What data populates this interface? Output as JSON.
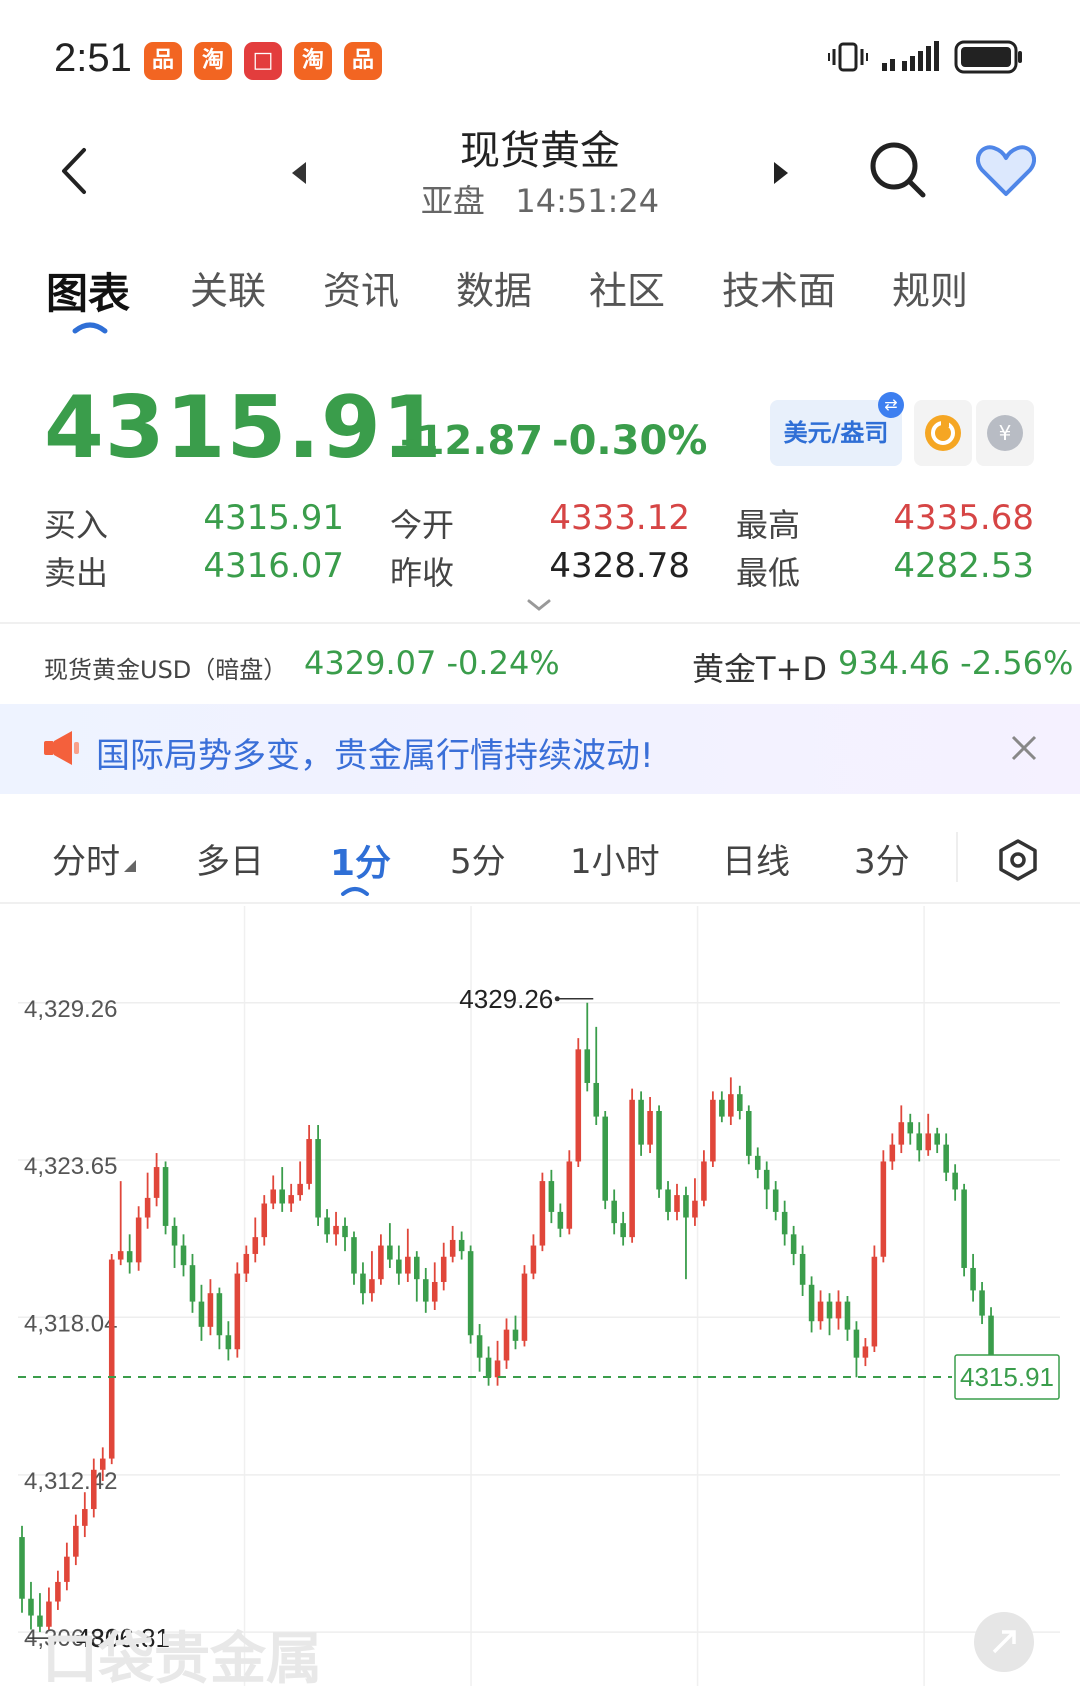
{
  "status_bar": {
    "time": "2:51",
    "apps": [
      {
        "glyph": "品",
        "color": "#f26522"
      },
      {
        "glyph": "淘",
        "color": "#f26522"
      },
      {
        "glyph": "□",
        "color": "#e33d3d"
      },
      {
        "glyph": "淘",
        "color": "#f26522"
      },
      {
        "glyph": "品",
        "color": "#f26522"
      }
    ]
  },
  "header": {
    "title": "现货黄金",
    "session": "亚盘",
    "time": "14:51:24"
  },
  "tabs": [
    "图表",
    "关联",
    "资讯",
    "数据",
    "社区",
    "技术面",
    "规则"
  ],
  "quote": {
    "price": "4315.91",
    "change": "-12.87",
    "change_pct": "-0.30%",
    "currency_toggle": "美元/盎司",
    "buy_label": "买入",
    "buy": "4315.91",
    "sell_label": "卖出",
    "sell": "4316.07",
    "open_label": "今开",
    "open": "4333.12",
    "prev_close_label": "昨收",
    "prev_close": "4328.78",
    "high_label": "最高",
    "high": "4335.68",
    "low_label": "最低",
    "low": "4282.53"
  },
  "related": {
    "left_name": "现货黄金USD（暗盘）",
    "left_value": "4329.07 -0.24%",
    "right_name": "黄金T+D",
    "right_value": "934.46 -2.56%"
  },
  "banner": {
    "text": "国际局势多变，贵金属行情持续波动!"
  },
  "periods": [
    "分时",
    "多日",
    "1分",
    "5分",
    "1小时",
    "日线",
    "3分"
  ],
  "colors": {
    "up": "#e0463a",
    "down": "#3a9d4b",
    "accent": "#2f6fd6"
  },
  "chart_data": {
    "type": "candlestick",
    "y_ticks": [
      "4,329.26",
      "4,323.65",
      "4,318.04",
      "4,312.42",
      "4,306.81"
    ],
    "ylim": [
      4305.6,
      4332.0
    ],
    "max_label": "4329.26",
    "min_label": "4306.81",
    "last_price": "4315.91",
    "watermark": "口袋贵金属",
    "candles": [
      {
        "o": 4310.2,
        "c": 4308.0,
        "h": 4310.6,
        "l": 4307.5
      },
      {
        "o": 4308.0,
        "c": 4307.4,
        "h": 4308.6,
        "l": 4306.9
      },
      {
        "o": 4307.4,
        "c": 4307.0,
        "h": 4308.2,
        "l": 4306.81
      },
      {
        "o": 4307.0,
        "c": 4307.9,
        "h": 4308.4,
        "l": 4306.9
      },
      {
        "o": 4307.9,
        "c": 4308.6,
        "h": 4309.0,
        "l": 4307.6
      },
      {
        "o": 4308.6,
        "c": 4309.5,
        "h": 4310.0,
        "l": 4308.3
      },
      {
        "o": 4309.5,
        "c": 4310.6,
        "h": 4311.0,
        "l": 4309.2
      },
      {
        "o": 4310.6,
        "c": 4311.2,
        "h": 4311.8,
        "l": 4310.2
      },
      {
        "o": 4311.2,
        "c": 4312.6,
        "h": 4313.0,
        "l": 4310.9
      },
      {
        "o": 4312.6,
        "c": 4313.0,
        "h": 4313.4,
        "l": 4312.2
      },
      {
        "o": 4313.0,
        "c": 4320.1,
        "h": 4320.3,
        "l": 4312.8
      },
      {
        "o": 4320.1,
        "c": 4320.4,
        "h": 4322.9,
        "l": 4319.9
      },
      {
        "o": 4320.4,
        "c": 4320.0,
        "h": 4321.0,
        "l": 4319.6
      },
      {
        "o": 4320.0,
        "c": 4321.6,
        "h": 4322.0,
        "l": 4319.7
      },
      {
        "o": 4321.6,
        "c": 4322.3,
        "h": 4323.2,
        "l": 4321.2
      },
      {
        "o": 4322.3,
        "c": 4323.4,
        "h": 4323.9,
        "l": 4322.0
      },
      {
        "o": 4323.4,
        "c": 4321.3,
        "h": 4323.6,
        "l": 4321.0
      },
      {
        "o": 4321.3,
        "c": 4320.6,
        "h": 4321.6,
        "l": 4319.8
      },
      {
        "o": 4320.6,
        "c": 4319.9,
        "h": 4321.0,
        "l": 4319.5
      },
      {
        "o": 4319.9,
        "c": 4318.6,
        "h": 4320.3,
        "l": 4318.2
      },
      {
        "o": 4318.6,
        "c": 4317.7,
        "h": 4319.2,
        "l": 4317.2
      },
      {
        "o": 4317.7,
        "c": 4318.9,
        "h": 4319.4,
        "l": 4317.4
      },
      {
        "o": 4318.9,
        "c": 4317.4,
        "h": 4319.1,
        "l": 4316.9
      },
      {
        "o": 4317.4,
        "c": 4316.9,
        "h": 4317.9,
        "l": 4316.5
      },
      {
        "o": 4316.9,
        "c": 4319.6,
        "h": 4320.0,
        "l": 4316.6
      },
      {
        "o": 4319.6,
        "c": 4320.3,
        "h": 4320.6,
        "l": 4319.3
      },
      {
        "o": 4320.3,
        "c": 4320.9,
        "h": 4321.6,
        "l": 4320.0
      },
      {
        "o": 4320.9,
        "c": 4322.1,
        "h": 4322.4,
        "l": 4320.6
      },
      {
        "o": 4322.1,
        "c": 4322.6,
        "h": 4323.1,
        "l": 4321.9
      },
      {
        "o": 4322.6,
        "c": 4322.1,
        "h": 4323.4,
        "l": 4321.8
      },
      {
        "o": 4322.1,
        "c": 4322.4,
        "h": 4322.8,
        "l": 4321.8
      },
      {
        "o": 4322.4,
        "c": 4322.8,
        "h": 4323.6,
        "l": 4322.2
      },
      {
        "o": 4322.8,
        "c": 4324.4,
        "h": 4324.9,
        "l": 4322.6
      },
      {
        "o": 4324.4,
        "c": 4321.6,
        "h": 4324.9,
        "l": 4321.3
      },
      {
        "o": 4321.6,
        "c": 4321.0,
        "h": 4321.9,
        "l": 4320.7
      },
      {
        "o": 4321.0,
        "c": 4321.3,
        "h": 4321.8,
        "l": 4320.6
      },
      {
        "o": 4321.3,
        "c": 4320.9,
        "h": 4321.6,
        "l": 4320.4
      },
      {
        "o": 4320.9,
        "c": 4319.6,
        "h": 4321.1,
        "l": 4319.2
      },
      {
        "o": 4319.6,
        "c": 4318.9,
        "h": 4320.0,
        "l": 4318.5
      },
      {
        "o": 4318.9,
        "c": 4319.4,
        "h": 4320.4,
        "l": 4318.6
      },
      {
        "o": 4319.4,
        "c": 4320.6,
        "h": 4321.0,
        "l": 4319.2
      },
      {
        "o": 4320.6,
        "c": 4320.1,
        "h": 4321.4,
        "l": 4319.8
      },
      {
        "o": 4320.1,
        "c": 4319.6,
        "h": 4320.6,
        "l": 4319.2
      },
      {
        "o": 4319.6,
        "c": 4320.2,
        "h": 4321.2,
        "l": 4319.3
      },
      {
        "o": 4320.2,
        "c": 4319.4,
        "h": 4320.4,
        "l": 4318.6
      },
      {
        "o": 4319.4,
        "c": 4318.6,
        "h": 4319.8,
        "l": 4318.2
      },
      {
        "o": 4318.6,
        "c": 4319.3,
        "h": 4320.0,
        "l": 4318.3
      },
      {
        "o": 4319.3,
        "c": 4320.2,
        "h": 4320.7,
        "l": 4319.0
      },
      {
        "o": 4320.2,
        "c": 4320.8,
        "h": 4321.3,
        "l": 4320.0
      },
      {
        "o": 4320.8,
        "c": 4320.4,
        "h": 4321.1,
        "l": 4320.1
      },
      {
        "o": 4320.4,
        "c": 4317.4,
        "h": 4320.6,
        "l": 4317.1
      },
      {
        "o": 4317.4,
        "c": 4316.6,
        "h": 4317.8,
        "l": 4316.1
      },
      {
        "o": 4316.6,
        "c": 4315.9,
        "h": 4317.0,
        "l": 4315.6
      },
      {
        "o": 4315.9,
        "c": 4316.5,
        "h": 4317.2,
        "l": 4315.6
      },
      {
        "o": 4316.5,
        "c": 4317.6,
        "h": 4318.0,
        "l": 4316.2
      },
      {
        "o": 4317.6,
        "c": 4317.2,
        "h": 4318.1,
        "l": 4316.9
      },
      {
        "o": 4317.2,
        "c": 4319.6,
        "h": 4319.9,
        "l": 4317.0
      },
      {
        "o": 4319.6,
        "c": 4320.6,
        "h": 4321.0,
        "l": 4319.4
      },
      {
        "o": 4320.6,
        "c": 4322.9,
        "h": 4323.2,
        "l": 4320.4
      },
      {
        "o": 4322.9,
        "c": 4321.8,
        "h": 4323.3,
        "l": 4321.4
      },
      {
        "o": 4321.8,
        "c": 4321.2,
        "h": 4322.1,
        "l": 4320.9
      },
      {
        "o": 4321.2,
        "c": 4323.6,
        "h": 4324.0,
        "l": 4321.0
      },
      {
        "o": 4323.6,
        "c": 4327.6,
        "h": 4328.0,
        "l": 4323.4
      },
      {
        "o": 4327.6,
        "c": 4326.4,
        "h": 4329.26,
        "l": 4326.1
      },
      {
        "o": 4326.4,
        "c": 4325.2,
        "h": 4328.4,
        "l": 4324.9
      },
      {
        "o": 4325.2,
        "c": 4322.2,
        "h": 4325.4,
        "l": 4321.9
      },
      {
        "o": 4322.2,
        "c": 4321.4,
        "h": 4322.6,
        "l": 4321.0
      },
      {
        "o": 4321.4,
        "c": 4320.9,
        "h": 4321.8,
        "l": 4320.6
      },
      {
        "o": 4320.9,
        "c": 4325.8,
        "h": 4326.2,
        "l": 4320.7
      },
      {
        "o": 4325.8,
        "c": 4324.2,
        "h": 4326.1,
        "l": 4323.8
      },
      {
        "o": 4324.2,
        "c": 4325.4,
        "h": 4325.9,
        "l": 4323.9
      },
      {
        "o": 4325.4,
        "c": 4322.6,
        "h": 4325.6,
        "l": 4322.3
      },
      {
        "o": 4322.6,
        "c": 4321.8,
        "h": 4322.9,
        "l": 4321.5
      },
      {
        "o": 4321.8,
        "c": 4322.4,
        "h": 4322.8,
        "l": 4321.5
      },
      {
        "o": 4322.4,
        "c": 4321.6,
        "h": 4322.7,
        "l": 4319.4
      },
      {
        "o": 4321.6,
        "c": 4322.2,
        "h": 4323.0,
        "l": 4321.3
      },
      {
        "o": 4322.2,
        "c": 4323.6,
        "h": 4324.0,
        "l": 4322.0
      },
      {
        "o": 4323.6,
        "c": 4325.8,
        "h": 4326.1,
        "l": 4323.4
      },
      {
        "o": 4325.8,
        "c": 4325.2,
        "h": 4326.1,
        "l": 4325.0
      },
      {
        "o": 4325.2,
        "c": 4326.0,
        "h": 4326.6,
        "l": 4324.9
      },
      {
        "o": 4326.0,
        "c": 4325.4,
        "h": 4326.3,
        "l": 4325.1
      },
      {
        "o": 4325.4,
        "c": 4323.8,
        "h": 4325.6,
        "l": 4323.5
      },
      {
        "o": 4323.8,
        "c": 4323.3,
        "h": 4324.1,
        "l": 4323.0
      },
      {
        "o": 4323.3,
        "c": 4322.6,
        "h": 4323.6,
        "l": 4321.9
      },
      {
        "o": 4322.6,
        "c": 4321.8,
        "h": 4322.9,
        "l": 4321.5
      },
      {
        "o": 4321.8,
        "c": 4321.0,
        "h": 4322.2,
        "l": 4320.6
      },
      {
        "o": 4321.0,
        "c": 4320.3,
        "h": 4321.3,
        "l": 4319.9
      },
      {
        "o": 4320.3,
        "c": 4319.2,
        "h": 4320.6,
        "l": 4318.8
      },
      {
        "o": 4319.2,
        "c": 4317.9,
        "h": 4319.5,
        "l": 4317.5
      },
      {
        "o": 4317.9,
        "c": 4318.6,
        "h": 4319.0,
        "l": 4317.6
      },
      {
        "o": 4318.6,
        "c": 4318.0,
        "h": 4318.9,
        "l": 4317.4
      },
      {
        "o": 4318.0,
        "c": 4318.6,
        "h": 4319.0,
        "l": 4317.6
      },
      {
        "o": 4318.6,
        "c": 4317.6,
        "h": 4318.8,
        "l": 4317.2
      },
      {
        "o": 4317.6,
        "c": 4316.6,
        "h": 4317.9,
        "l": 4315.9
      },
      {
        "o": 4316.6,
        "c": 4317.0,
        "h": 4317.3,
        "l": 4316.3
      },
      {
        "o": 4317.0,
        "c": 4320.2,
        "h": 4320.6,
        "l": 4316.8
      },
      {
        "o": 4320.2,
        "c": 4323.6,
        "h": 4324.0,
        "l": 4320.0
      },
      {
        "o": 4323.6,
        "c": 4324.2,
        "h": 4324.6,
        "l": 4323.3
      },
      {
        "o": 4324.2,
        "c": 4325.0,
        "h": 4325.6,
        "l": 4323.9
      },
      {
        "o": 4325.0,
        "c": 4324.6,
        "h": 4325.3,
        "l": 4324.2
      },
      {
        "o": 4324.6,
        "c": 4324.0,
        "h": 4325.0,
        "l": 4323.6
      },
      {
        "o": 4324.0,
        "c": 4324.6,
        "h": 4325.3,
        "l": 4323.8
      },
      {
        "o": 4324.6,
        "c": 4324.2,
        "h": 4324.8,
        "l": 4323.9
      },
      {
        "o": 4324.2,
        "c": 4323.2,
        "h": 4324.6,
        "l": 4322.9
      },
      {
        "o": 4323.2,
        "c": 4322.6,
        "h": 4323.5,
        "l": 4322.2
      },
      {
        "o": 4322.6,
        "c": 4319.8,
        "h": 4322.8,
        "l": 4319.5
      },
      {
        "o": 4319.8,
        "c": 4319.0,
        "h": 4320.3,
        "l": 4318.6
      },
      {
        "o": 4319.0,
        "c": 4318.1,
        "h": 4319.3,
        "l": 4317.8
      },
      {
        "o": 4318.1,
        "c": 4316.0,
        "h": 4318.4,
        "l": 4315.7
      },
      {
        "o": 4316.0,
        "c": 4315.91,
        "h": 4316.3,
        "l": 4315.5
      }
    ]
  }
}
